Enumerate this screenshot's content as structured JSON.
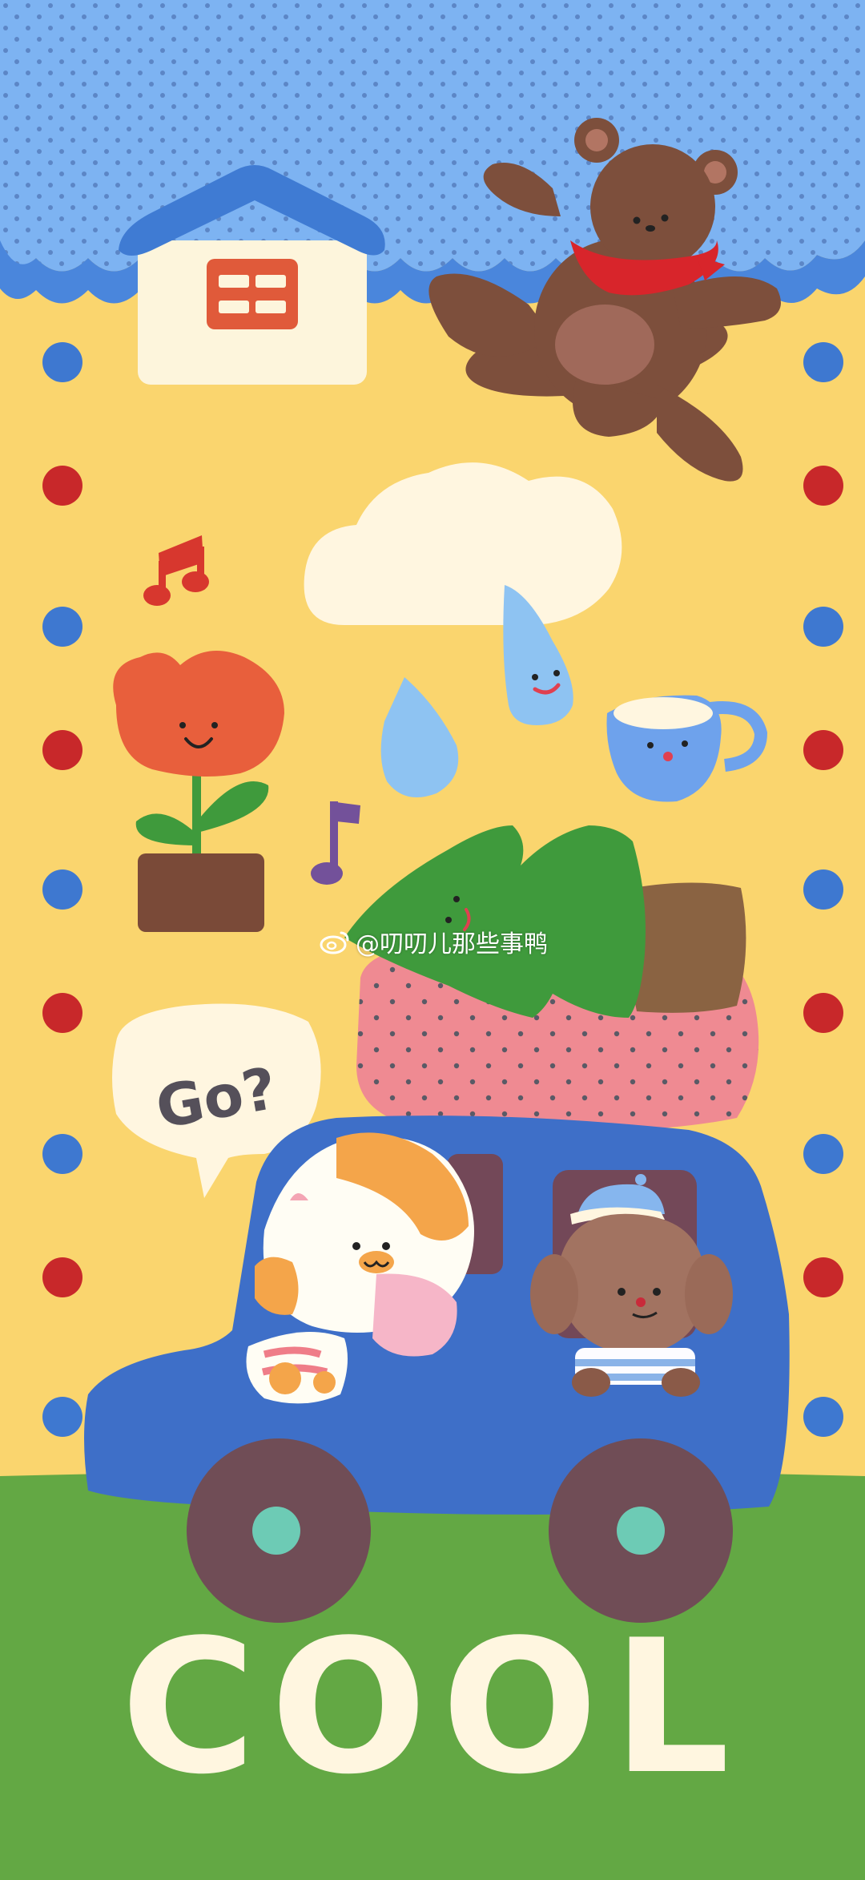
{
  "speech_bubble": {
    "text": "Go?"
  },
  "title": {
    "text": "COOL"
  },
  "watermark": {
    "text": "@叨叨儿那些事鸭",
    "icon": "weibo-logo-icon"
  },
  "colors": {
    "sky": "#7db3f2",
    "scallop": "#4a86dc",
    "yellow": "#fad56e",
    "grass": "#63a844",
    "car": "#3e6fc8",
    "bear": "#7d4f3c",
    "blanket": "#ef8a92",
    "tree": "#3f9a3c",
    "cream": "#fff6e0"
  }
}
